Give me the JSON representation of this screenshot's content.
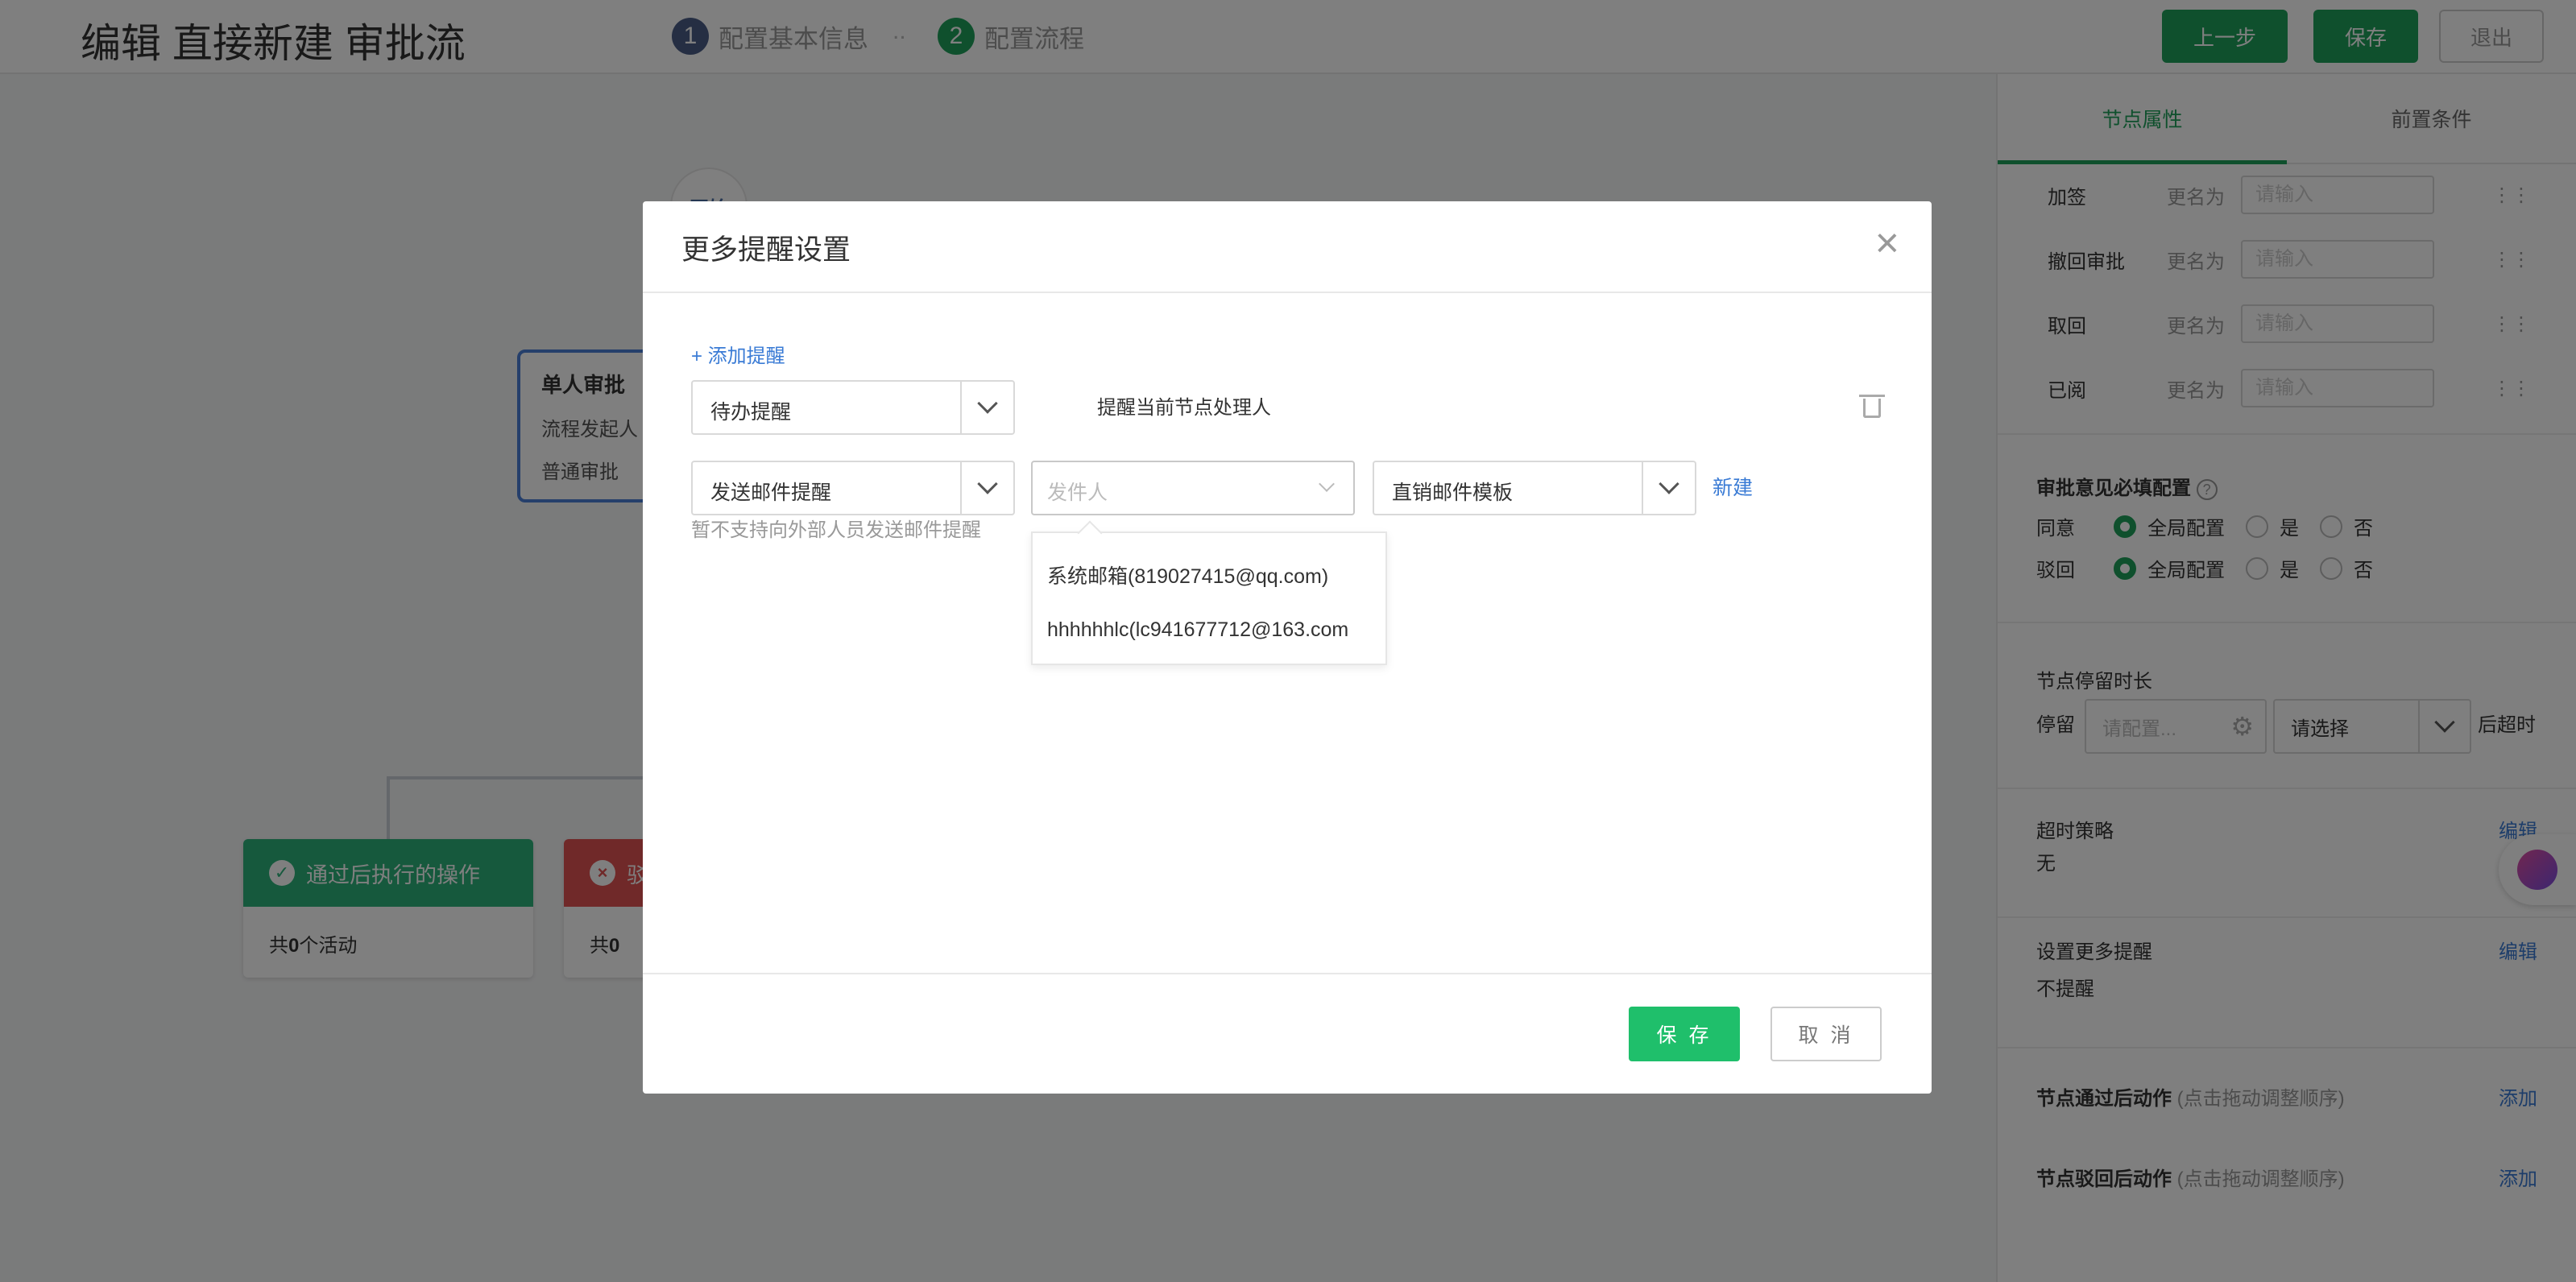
{
  "header": {
    "title": "编辑 直接新建 审批流",
    "steps": [
      {
        "num": "1",
        "label": "配置基本信息"
      },
      {
        "num": "2",
        "label": "配置流程"
      }
    ],
    "step_separator": "..",
    "buttons": {
      "prev": "上一步",
      "save": "保存",
      "exit": "退出"
    }
  },
  "canvas": {
    "start_label": "开始",
    "approve_node": {
      "title": "单人审批",
      "line1": "流程发起人",
      "line2": "普通审批"
    },
    "pass_card": {
      "title": "通过后执行的操作",
      "count_prefix": "共",
      "count": "0",
      "count_suffix": "个活动"
    },
    "reject_card": {
      "title": "驳",
      "count_prefix": "共",
      "count": "0"
    }
  },
  "sidepanel": {
    "tabs": [
      "节点属性",
      "前置条件"
    ],
    "rename_rows": [
      {
        "label": "加签",
        "as": "更名为",
        "placeholder": "请输入"
      },
      {
        "label": "撤回审批",
        "as": "更名为",
        "placeholder": "请输入"
      },
      {
        "label": "取回",
        "as": "更名为",
        "placeholder": "请输入"
      },
      {
        "label": "已阅",
        "as": "更名为",
        "placeholder": "请输入"
      }
    ],
    "opinion": {
      "title": "审批意见必填配置",
      "rows": [
        {
          "label": "同意",
          "options": [
            "全局配置",
            "是",
            "否"
          ],
          "selected": 0
        },
        {
          "label": "驳回",
          "options": [
            "全局配置",
            "是",
            "否"
          ],
          "selected": 0
        }
      ]
    },
    "stay": {
      "title": "节点停留时长",
      "label": "停留",
      "input_placeholder": "请配置...",
      "select_value": "请选择",
      "suffix": "后超时"
    },
    "timeout": {
      "title": "超时策略",
      "value": "无",
      "edit": "编辑"
    },
    "more_remind": {
      "title": "设置更多提醒",
      "value": "不提醒",
      "edit": "编辑"
    },
    "after_pass": {
      "title": "节点通过后动作",
      "hint": "(点击拖动调整顺序)",
      "add": "添加"
    },
    "after_reject": {
      "title": "节点驳回后动作",
      "hint": "(点击拖动调整顺序)",
      "add": "添加"
    }
  },
  "modal": {
    "title": "更多提醒设置",
    "add_link": "+ 添加提醒",
    "row1": {
      "type": "待办提醒",
      "desc": "提醒当前节点处理人"
    },
    "row2": {
      "type": "发送邮件提醒",
      "sender_placeholder": "发件人",
      "template": "直销邮件模板",
      "new_link": "新建"
    },
    "note": "暂不支持向外部人员发送邮件提醒",
    "sender_options": [
      "系统邮箱(819027415@qq.com)",
      "hhhhhhlc(lc941677712@163.com"
    ],
    "save": "保 存",
    "cancel": "取 消"
  },
  "colors": {
    "accent": "#1fa05a",
    "link": "#3a7bd5",
    "reject": "#e05252",
    "pass": "#2db37a"
  }
}
